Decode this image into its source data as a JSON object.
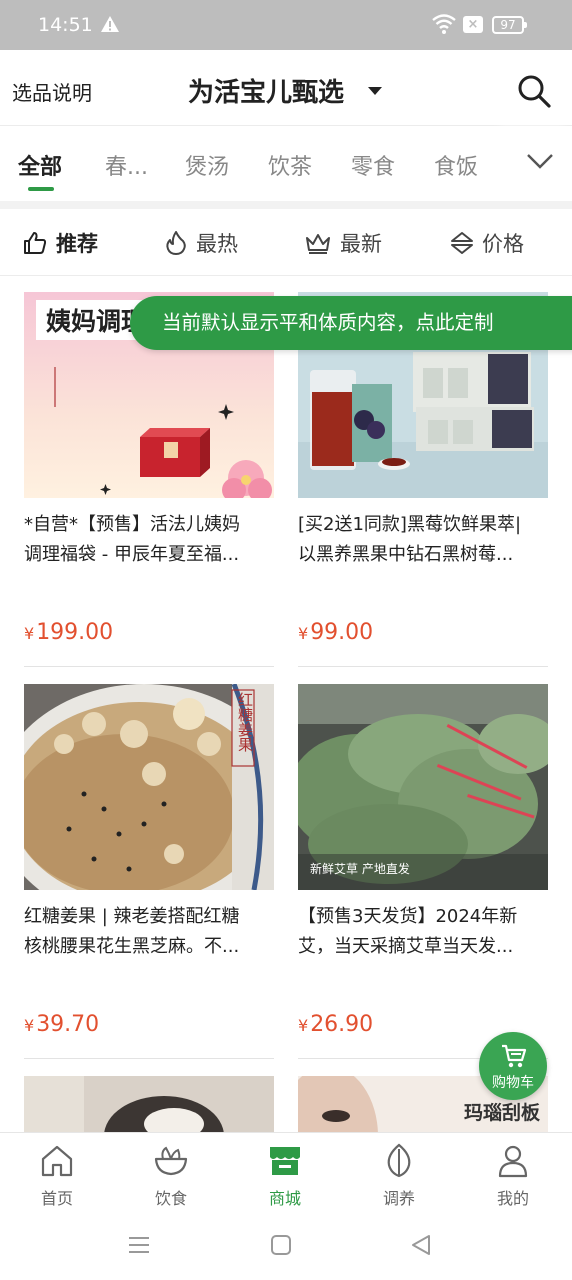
{
  "status_bar": {
    "time": "14:51",
    "battery": "97"
  },
  "header": {
    "left_link": "选品说明",
    "title": "为活宝儿甄选"
  },
  "categories": [
    "全部",
    "春...",
    "煲汤",
    "饮茶",
    "零食",
    "食饭"
  ],
  "sort_options": [
    "推荐",
    "最热",
    "最新",
    "价格"
  ],
  "banner": "当前默认显示平和体质内容，点此定制",
  "products": [
    {
      "name_line1": "*自营*【预售】活法儿姨妈",
      "name_line2": "调理福袋 - 甲辰年夏至福...",
      "price": "199.00",
      "image_text": "姨妈调理"
    },
    {
      "name_line1": "[买2送1同款]黑莓饮鲜果萃|",
      "name_line2": "以黑养黑果中钻石黑树莓...",
      "price": "99.00"
    },
    {
      "name_line1": "红糖姜果 | 辣老姜搭配红糖",
      "name_line2": "核桃腰果花生黑芝麻。不...",
      "price": "39.70",
      "image_text": "红糖姜果"
    },
    {
      "name_line1": "【预售3天发货】2024年新",
      "name_line2": "艾，当天采摘艾草当天发...",
      "price": "26.90",
      "image_text": "新鲜艾草 产地直发"
    },
    {
      "name_line1": "",
      "name_line2": "",
      "price": ""
    },
    {
      "name_line1": "",
      "name_line2": "",
      "price": "",
      "image_text": "玛瑙刮板"
    }
  ],
  "currency_symbol": "¥",
  "cart_label": "购物车",
  "bottom_nav": [
    "首页",
    "饮食",
    "商城",
    "调养",
    "我的"
  ],
  "colors": {
    "accent": "#2e9a46",
    "price": "#e2502f",
    "status_bar": "#bdbdbd"
  }
}
